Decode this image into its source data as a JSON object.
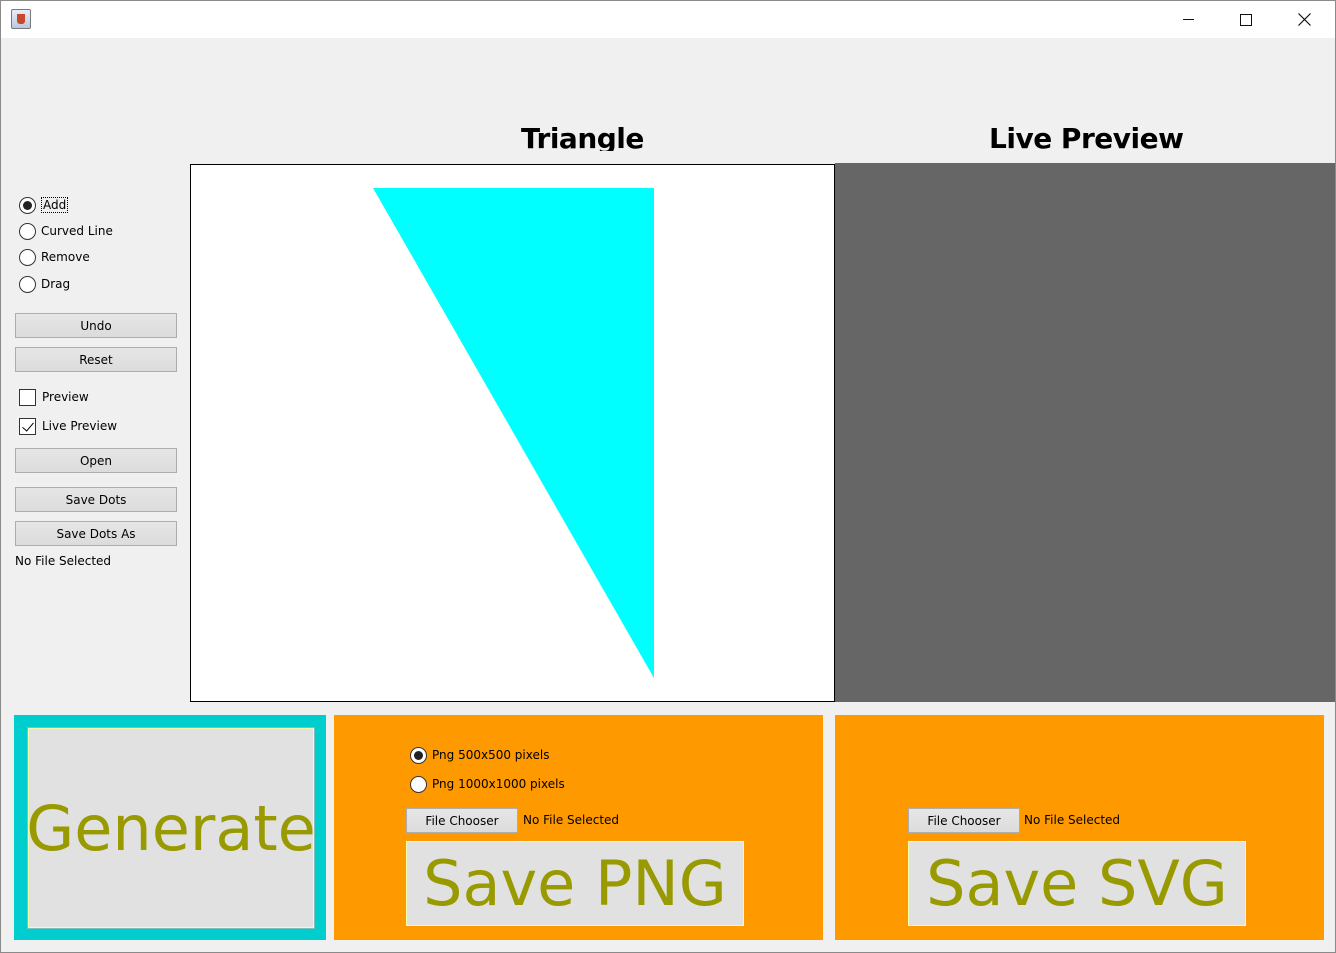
{
  "window": {
    "minimize_icon": "minimize-icon",
    "maximize_icon": "maximize-icon",
    "close_icon": "close-icon"
  },
  "headings": {
    "triangle": "Triangle",
    "live_preview": "Live Preview"
  },
  "tools": {
    "modes": [
      {
        "label": "Add",
        "selected": true
      },
      {
        "label": "Curved Line",
        "selected": false
      },
      {
        "label": "Remove",
        "selected": false
      },
      {
        "label": "Drag",
        "selected": false
      }
    ],
    "undo_label": "Undo",
    "reset_label": "Reset",
    "preview_label": "Preview",
    "preview_checked": false,
    "live_preview_label": "Live Preview",
    "live_preview_checked": true,
    "open_label": "Open",
    "save_dots_label": "Save Dots",
    "save_dots_as_label": "Save Dots As",
    "file_status": "No File Selected"
  },
  "canvas": {
    "shape_color": "#00ffff",
    "preview_bg": "#666666"
  },
  "generate": {
    "label": "Generate",
    "panel_color": "#00cdcd",
    "text_color": "#999900"
  },
  "png_panel": {
    "options": [
      {
        "label": "Png 500x500 pixels",
        "selected": true
      },
      {
        "label": "Png 1000x1000 pixels",
        "selected": false
      }
    ],
    "file_chooser_label": "File Chooser",
    "file_status": "No File Selected",
    "save_label": "Save PNG",
    "panel_color": "#ff9900"
  },
  "svg_panel": {
    "file_chooser_label": "File Chooser",
    "file_status": "No File Selected",
    "save_label": "Save SVG",
    "panel_color": "#ff9900"
  }
}
